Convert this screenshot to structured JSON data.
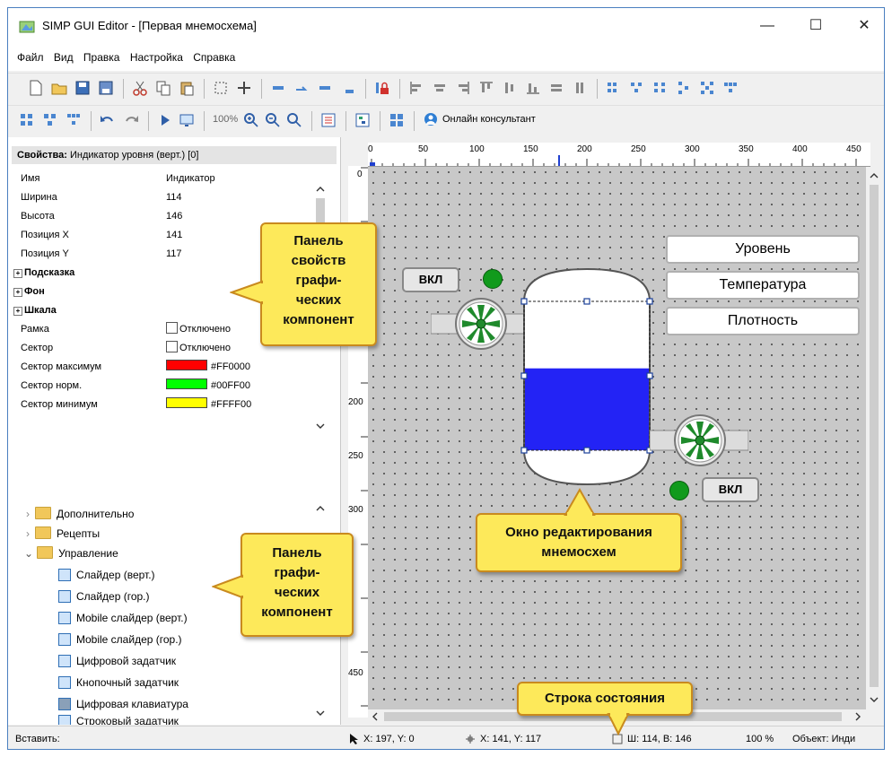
{
  "window": {
    "title": "SIMP GUI Editor - [Первая мнемосхема]",
    "minimize": "—",
    "maximize": "☐",
    "close": "✕"
  },
  "menu": [
    "Файл",
    "Вид",
    "Правка",
    "Настройка",
    "Справка"
  ],
  "toolbar2": {
    "zoom": "100%",
    "consultant": "Онлайн консультант"
  },
  "properties": {
    "header_bold": "Свойства:",
    "header_rest": " Индикатор уровня (верт.) [0]",
    "rows": [
      {
        "key": "Имя",
        "value": "Индикатор"
      },
      {
        "key": "Ширина",
        "value": "114"
      },
      {
        "key": "Высота",
        "value": "146"
      },
      {
        "key": "Позиция X",
        "value": "141"
      },
      {
        "key": "Позиция Y",
        "value": "117"
      }
    ],
    "groups": [
      "Подсказка",
      "Фон",
      "Шкала"
    ],
    "checks": [
      {
        "key": "Рамка",
        "value": "Отключено"
      },
      {
        "key": "Сектор",
        "value": "Отключено"
      }
    ],
    "colors": [
      {
        "key": "Сектор максимум",
        "value": "#FF0000",
        "color": "#ff0000"
      },
      {
        "key": "Сектор норм.",
        "value": "#00FF00",
        "color": "#00ff00"
      },
      {
        "key": "Сектор минимум",
        "value": "#FFFF00",
        "color": "#ffff00"
      }
    ]
  },
  "tree": {
    "folders": [
      "Дополнительно",
      "Рецепты",
      "Управление"
    ],
    "items": [
      "Слайдер (верт.)",
      "Слайдер (гор.)",
      "Mobile слайдер (верт.)",
      "Mobile слайдер (гор.)",
      "Цифровой задатчик",
      "Кнопочный задатчик",
      "Цифровая клавиатура",
      "Строковый задатчик"
    ]
  },
  "ruler": {
    "top": [
      "0",
      "50",
      "100",
      "150",
      "200",
      "250",
      "300",
      "350",
      "400",
      "450"
    ],
    "left": [
      "0",
      "200",
      "250",
      "300",
      "450"
    ]
  },
  "scheme": {
    "btn_on_1": "ВКЛ",
    "btn_on_2": "ВКЛ",
    "field_1": "Уровень",
    "field_2": "Температура",
    "field_3": "Плотность",
    "tank_fill": "#2323f5",
    "tank_level_fraction": 0.55
  },
  "status": {
    "left": "Вставить:",
    "cursor": "X: 197, Y: 0",
    "pos": "X: 141, Y: 117",
    "size": "Ш: 114, В: 146",
    "zoom": "100 %",
    "object": "Объект: Инди"
  },
  "callouts": {
    "props": [
      "Панель",
      "свойств",
      "графи-",
      "ческих",
      "компонент"
    ],
    "components": [
      "Панель",
      "графи-",
      "ческих",
      "компонент"
    ],
    "editor": [
      "Окно редактирования",
      "мнемосхем"
    ],
    "status": [
      "Строка состояния"
    ]
  }
}
